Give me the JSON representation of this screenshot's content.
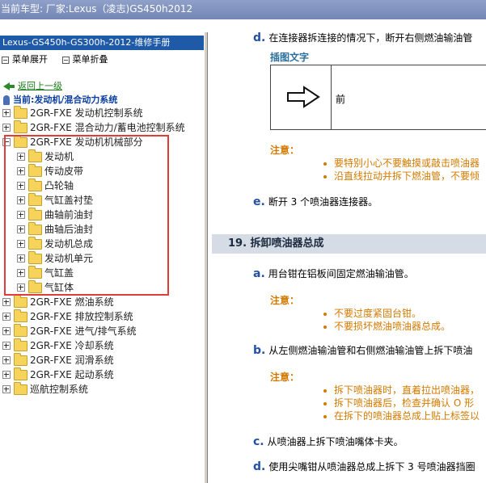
{
  "window": {
    "title": "当前车型:  厂家:Lexus（凌志)GS450h2012"
  },
  "left": {
    "manual_title": "Lexus-GS450h-GS300h-2012-维修手册",
    "expand_all": "菜单展开",
    "collapse_all": "菜单折叠",
    "back_link": "返回上一级",
    "current": "当前:发动机/混合动力系统",
    "tree": [
      {
        "label": "2GR-FXE 发动机控制系统",
        "level": 0,
        "expanded": false
      },
      {
        "label": "2GR-FXE 混合动力/蓄电池控制系统",
        "level": 0,
        "expanded": false
      },
      {
        "label": "2GR-FXE 发动机机械部分",
        "level": 0,
        "expanded": true
      },
      {
        "label": "发动机",
        "level": 1,
        "expanded": false
      },
      {
        "label": "传动皮带",
        "level": 1,
        "expanded": false
      },
      {
        "label": "凸轮轴",
        "level": 1,
        "expanded": false
      },
      {
        "label": "气缸盖衬垫",
        "level": 1,
        "expanded": false
      },
      {
        "label": "曲轴前油封",
        "level": 1,
        "expanded": false
      },
      {
        "label": "曲轴后油封",
        "level": 1,
        "expanded": false
      },
      {
        "label": "发动机总成",
        "level": 1,
        "expanded": false
      },
      {
        "label": "发动机单元",
        "level": 1,
        "expanded": false
      },
      {
        "label": "气缸盖",
        "level": 1,
        "expanded": false
      },
      {
        "label": "气缸体",
        "level": 1,
        "expanded": false
      },
      {
        "label": "2GR-FXE 燃油系统",
        "level": 0,
        "expanded": false
      },
      {
        "label": "2GR-FXE 排放控制系统",
        "level": 0,
        "expanded": false
      },
      {
        "label": "2GR-FXE 进气/排气系统",
        "level": 0,
        "expanded": false
      },
      {
        "label": "2GR-FXE 冷却系统",
        "level": 0,
        "expanded": false
      },
      {
        "label": "2GR-FXE 润滑系统",
        "level": 0,
        "expanded": false
      },
      {
        "label": "2GR-FXE 起动系统",
        "level": 0,
        "expanded": false
      },
      {
        "label": "巡航控制系统",
        "level": 0,
        "expanded": false
      }
    ]
  },
  "right": {
    "step_d1": {
      "letter": "d.",
      "text": "在连接器拆连接的情况下，断开右侧燃油输油管"
    },
    "caption": "插图文字",
    "illus_label": "前",
    "note1": {
      "label": "注意：",
      "items": [
        "要特别小心不要触摸或敲击喷油器",
        "沿直线拉动并拆下燃油管，不要倾"
      ]
    },
    "step_e": {
      "letter": "e.",
      "text": "断开 3 个喷油器连接器。"
    },
    "section": "19. 拆卸喷油器总成",
    "step_a": {
      "letter": "a.",
      "text": "用台钳在铝板间固定燃油输油管。"
    },
    "note2": {
      "label": "注意：",
      "items": [
        "不要过度紧固台钳。",
        "不要损坏燃油喷油器总成。"
      ]
    },
    "step_b": {
      "letter": "b.",
      "text": "从左侧燃油输油管和右侧燃油输油管上拆下喷油"
    },
    "note3": {
      "label": "注意：",
      "items": [
        "拆下喷油器时，直着拉出喷油器，",
        "拆下喷油器后，检查并确认 O 形",
        "在拆下的喷油器总成上贴上标签以"
      ]
    },
    "step_c": {
      "letter": "c.",
      "text": "从喷油器上拆下喷油嘴体卡夹。"
    },
    "step_d2": {
      "letter": "d.",
      "text": "使用尖嘴钳从喷油器总成上拆下 3 号喷油器挡圈"
    }
  }
}
